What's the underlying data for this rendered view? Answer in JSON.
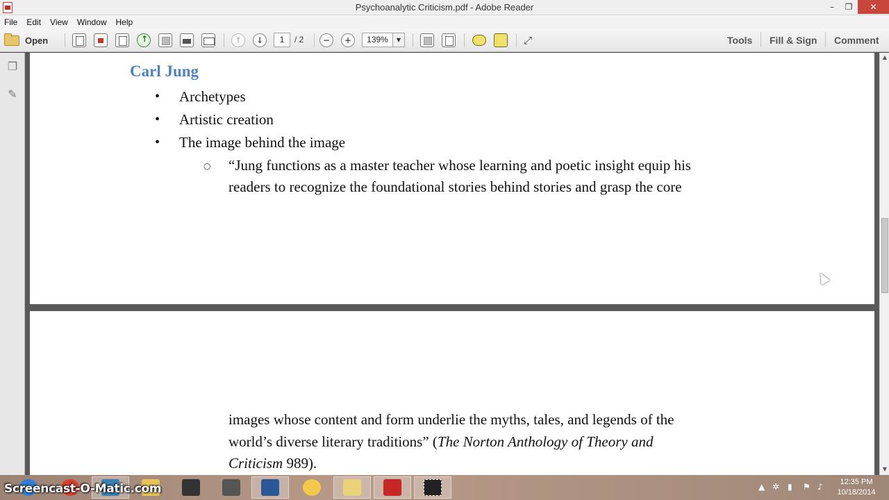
{
  "window": {
    "title": "Psychoanalytic Criticism.pdf - Adobe Reader",
    "minimize_glyph": "–",
    "restore_glyph": "❐",
    "close_glyph": "✕"
  },
  "menu": [
    "File",
    "Edit",
    "View",
    "Window",
    "Help"
  ],
  "toolbar": {
    "open_label": "Open",
    "page_current": "1",
    "page_total": "/ 2",
    "zoom": "139%",
    "zoom_dropdown_glyph": "▼",
    "prev_page_glyph": "↑",
    "next_page_glyph": "↓",
    "zoom_out_glyph": "−",
    "zoom_in_glyph": "+",
    "tools_label": "Tools",
    "fill_sign_label": "Fill & Sign",
    "comment_label": "Comment"
  },
  "document": {
    "heading": "Carl Jung",
    "bullet_glyph": "•",
    "sub_bullet_glyph": "○",
    "bullets": [
      "Archetypes",
      "Artistic creation",
      "The image behind the image"
    ],
    "quote_line_1": "“Jung functions as a master teacher whose learning and poetic insight equip his",
    "quote_line_2": "readers to recognize the foundational stories behind stories and grasp the core",
    "quote_line_3": "images whose content and form underlie the myths, tales, and legends of the",
    "quote_line_4a": "world’s diverse literary traditions” (",
    "quote_line_4b": "The Norton Anthology of Theory and",
    "quote_line_5a": "Criticism",
    "quote_line_5b": " 989)."
  },
  "scrollbar": {
    "up_glyph": "▲",
    "down_glyph": "▼"
  },
  "taskbar": {
    "watermark": "Screencast-O-Matic.com",
    "time": "12:35 PM",
    "date": "10/18/2014",
    "tray_arrow": "▲",
    "apps": [
      {
        "name": "internet-explorer",
        "color": "#2f7fd6"
      },
      {
        "name": "chrome",
        "color": "#d9412e"
      },
      {
        "name": "photos",
        "color": "#3c7fb1"
      },
      {
        "name": "file-explorer",
        "color": "#e7c45a"
      },
      {
        "name": "touch-app",
        "color": "#333333"
      },
      {
        "name": "som-app",
        "color": "#555555"
      },
      {
        "name": "word",
        "color": "#2b5797"
      },
      {
        "name": "sun-app",
        "color": "#f2c94c"
      },
      {
        "name": "folder-app",
        "color": "#e8d27a"
      },
      {
        "name": "adobe-reader",
        "color": "#c62828"
      },
      {
        "name": "snipping-tool",
        "color": "#222222"
      }
    ]
  }
}
